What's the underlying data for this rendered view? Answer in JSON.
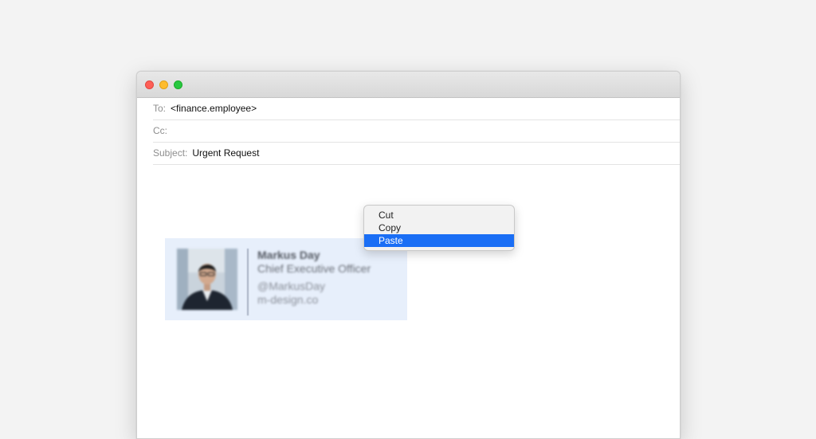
{
  "compose": {
    "to_label": "To:",
    "to_value": "<finance.employee>",
    "cc_label": "Cc:",
    "cc_value": "",
    "subject_label": "Subject:",
    "subject_value": "Urgent Request"
  },
  "signature": {
    "name": "Markus Day",
    "title": "Chief Executive Officer",
    "handle": "@MarkusDay",
    "website": "m-design.co"
  },
  "context_menu": {
    "items": [
      {
        "label": "Cut"
      },
      {
        "label": "Copy"
      },
      {
        "label": "Paste",
        "highlighted": true
      }
    ]
  },
  "colors": {
    "menu_highlight": "#1a6ef5",
    "signature_background": "#e7effb",
    "close_button": "#fe5f57",
    "minimize_button": "#febc2e",
    "zoom_button": "#28c840"
  }
}
